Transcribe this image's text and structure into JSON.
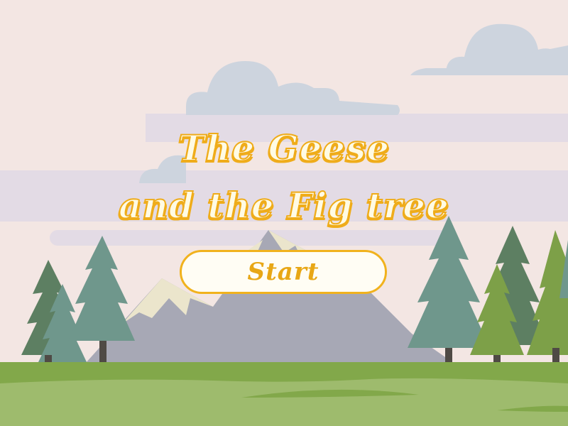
{
  "game": {
    "title_line_1": "The Geese",
    "title_line_2": "and the Fig tree",
    "start_label": "Start"
  },
  "colors": {
    "sky": "#f3e6e3",
    "haze_band": "#e3dbe5",
    "clouds": "#cdd4de",
    "mountain": "#a7a8b5",
    "mountain_snow": "#ebe5cc",
    "pine_dark": "#5d7f62",
    "pine_teal": "#6f978c",
    "pine_light": "#7da048",
    "grass": "#9ebb6d",
    "grass_strip": "#82a84a",
    "title_fill": "#fffbe4",
    "title_outline": "#efac1a",
    "button_fill": "#fffdf4",
    "button_border": "#f1b21d"
  }
}
